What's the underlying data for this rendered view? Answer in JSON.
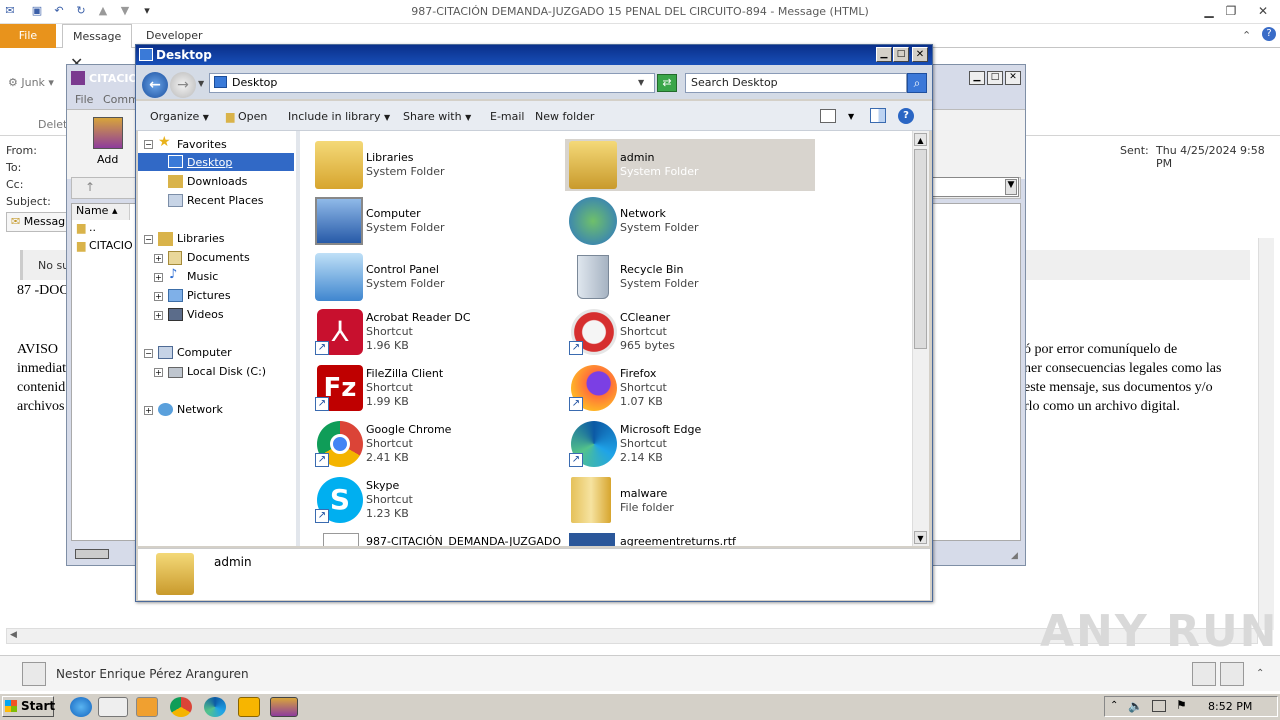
{
  "outlook": {
    "title": "987-CITACIÓN  DEMANDA-JUZGADO 15 PENAL DEL CIRCUITO-894  -  Message (HTML)",
    "tabs": [
      "File",
      "Message",
      "Developer"
    ],
    "ribbon_junk": "Junk",
    "ribbon_delete": "Delet",
    "header": {
      "from_label": "From:",
      "to_label": "To:",
      "cc_label": "Cc:",
      "subject_label": "Subject:",
      "sent_label": "Sent:",
      "sent_value": "Thu 4/25/2024 9:58 PM",
      "message_tab": "Messag"
    },
    "body": {
      "notice": "No su",
      "line1": "87 -DOC",
      "aviso_prefix": [
        "AVISO",
        "inmediat",
        "contenid",
        "archivos"
      ],
      "aviso_suffix": [
        "ó por error comuníquelo de",
        "ner consecuencias legales como las",
        "este mensaje, sus documentos y/o",
        "rlo como un archivo digital."
      ]
    },
    "people": {
      "name": "Nestor Enrique Pérez Aranguren"
    }
  },
  "winrar": {
    "title": "CITACIO",
    "menu": [
      "File",
      "Comm"
    ],
    "add_label": "Add",
    "col_name": "Name",
    "rows": [
      "..",
      "CITACIO"
    ]
  },
  "explorer": {
    "title": "Desktop",
    "address": "Desktop",
    "search_placeholder": "Search Desktop",
    "commands": [
      "Organize",
      "Open",
      "Include in library",
      "Share with",
      "E-mail",
      "New folder"
    ],
    "nav": {
      "favorites": "Favorites",
      "desktop": "Desktop",
      "downloads": "Downloads",
      "recent": "Recent Places",
      "libraries": "Libraries",
      "documents": "Documents",
      "music": "Music",
      "pictures": "Pictures",
      "videos": "Videos",
      "computer": "Computer",
      "localdisk": "Local Disk (C:)",
      "network": "Network"
    },
    "items": [
      {
        "name": "Libraries",
        "type": "System Folder",
        "size": "",
        "icon": "libraries-icon"
      },
      {
        "name": "admin",
        "type": "System Folder",
        "size": "",
        "icon": "user-folder-icon"
      },
      {
        "name": "Computer",
        "type": "System Folder",
        "size": "",
        "icon": "computer-icon"
      },
      {
        "name": "Network",
        "type": "System Folder",
        "size": "",
        "icon": "network-icon"
      },
      {
        "name": "Control Panel",
        "type": "System Folder",
        "size": "",
        "icon": "control-panel-icon"
      },
      {
        "name": "Recycle Bin",
        "type": "System Folder",
        "size": "",
        "icon": "recycle-bin-icon"
      },
      {
        "name": "Acrobat Reader DC",
        "type": "Shortcut",
        "size": "1.96 KB",
        "icon": "acrobat-icon"
      },
      {
        "name": "CCleaner",
        "type": "Shortcut",
        "size": "965 bytes",
        "icon": "ccleaner-icon"
      },
      {
        "name": "FileZilla Client",
        "type": "Shortcut",
        "size": "1.99 KB",
        "icon": "filezilla-icon"
      },
      {
        "name": "Firefox",
        "type": "Shortcut",
        "size": "1.07 KB",
        "icon": "firefox-icon"
      },
      {
        "name": "Google Chrome",
        "type": "Shortcut",
        "size": "2.41 KB",
        "icon": "chrome-icon"
      },
      {
        "name": "Microsoft Edge",
        "type": "Shortcut",
        "size": "2.14 KB",
        "icon": "edge-icon"
      },
      {
        "name": "Skype",
        "type": "Shortcut",
        "size": "1.23 KB",
        "icon": "skype-icon"
      },
      {
        "name": "malware",
        "type": "File folder",
        "size": "",
        "icon": "folder-icon"
      },
      {
        "name": "987-CITACIÓN_DEMANDA-JUZGADO",
        "type": "",
        "size": "",
        "icon": "document-icon"
      },
      {
        "name": "agreementreturns.rtf",
        "type": "",
        "size": "",
        "icon": "rtf-icon"
      }
    ],
    "details_name": "admin"
  },
  "taskbar": {
    "start": "Start",
    "clock": "8:52 PM"
  },
  "watermark": "ANY RUN",
  "colors": {
    "file_tab": "#e8931c",
    "explorer_title": "#184fb8",
    "selection": "#3169c6"
  }
}
